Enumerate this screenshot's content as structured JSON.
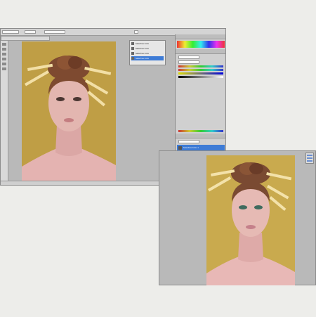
{
  "window1": {
    "history_panel": {
      "items": [
        "Selective Color",
        "Selective Color",
        "Selective Color",
        "Selective Color"
      ]
    },
    "layers_panel": {
      "selected_layer": "Selective Color 1"
    }
  },
  "window2": {},
  "colors": {
    "photo_background": "#c4a34a",
    "canvas_gray": "#b9b9b9",
    "selection_blue": "#3d7bd6"
  }
}
